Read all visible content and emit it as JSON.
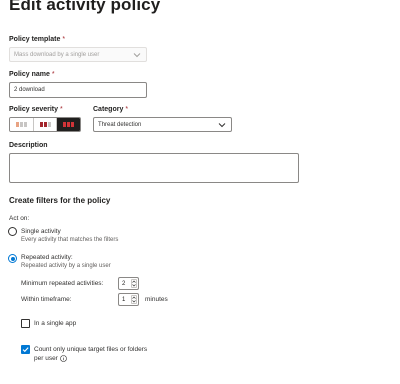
{
  "page": {
    "title": "Edit activity policy"
  },
  "policy_template": {
    "label": "Policy template",
    "required_mark": "*",
    "value": "Mass download by a single user"
  },
  "policy_name": {
    "label": "Policy name",
    "required_mark": "*",
    "value": "2 download"
  },
  "policy_severity": {
    "label": "Policy severity",
    "required_mark": "*",
    "options": [
      "low",
      "medium",
      "high"
    ],
    "selected": "high",
    "colors": {
      "low": "#c8c6c4",
      "medium_accent": "#a4262c",
      "low_accent": "#e8a383",
      "high": "#a4262c"
    }
  },
  "category": {
    "label": "Category",
    "required_mark": "*",
    "value": "Threat detection"
  },
  "description": {
    "label": "Description",
    "value": ""
  },
  "filters": {
    "title": "Create filters for the policy",
    "act_on_label": "Act on:",
    "single_activity": {
      "label": "Single activity",
      "sublabel": "Every activity that matches the filters",
      "checked": false
    },
    "repeated_activity": {
      "label": "Repeated activity:",
      "sublabel": "Repeated activity by a single user",
      "checked": true
    },
    "min_repeated": {
      "label": "Minimum repeated activities:",
      "value": "2"
    },
    "timeframe": {
      "label": "Within timeframe:",
      "value": "1",
      "unit": "minutes"
    },
    "single_app": {
      "label": "In a single app",
      "checked": false
    },
    "unique_targets": {
      "label_line1": "Count only unique target files or folders",
      "label_line2": "per user",
      "checked": true
    }
  },
  "icons": {
    "chevron": "chevron-down-icon",
    "info": "info-icon",
    "checkmark": "checkmark-icon"
  },
  "accent_color": "#0078d4"
}
